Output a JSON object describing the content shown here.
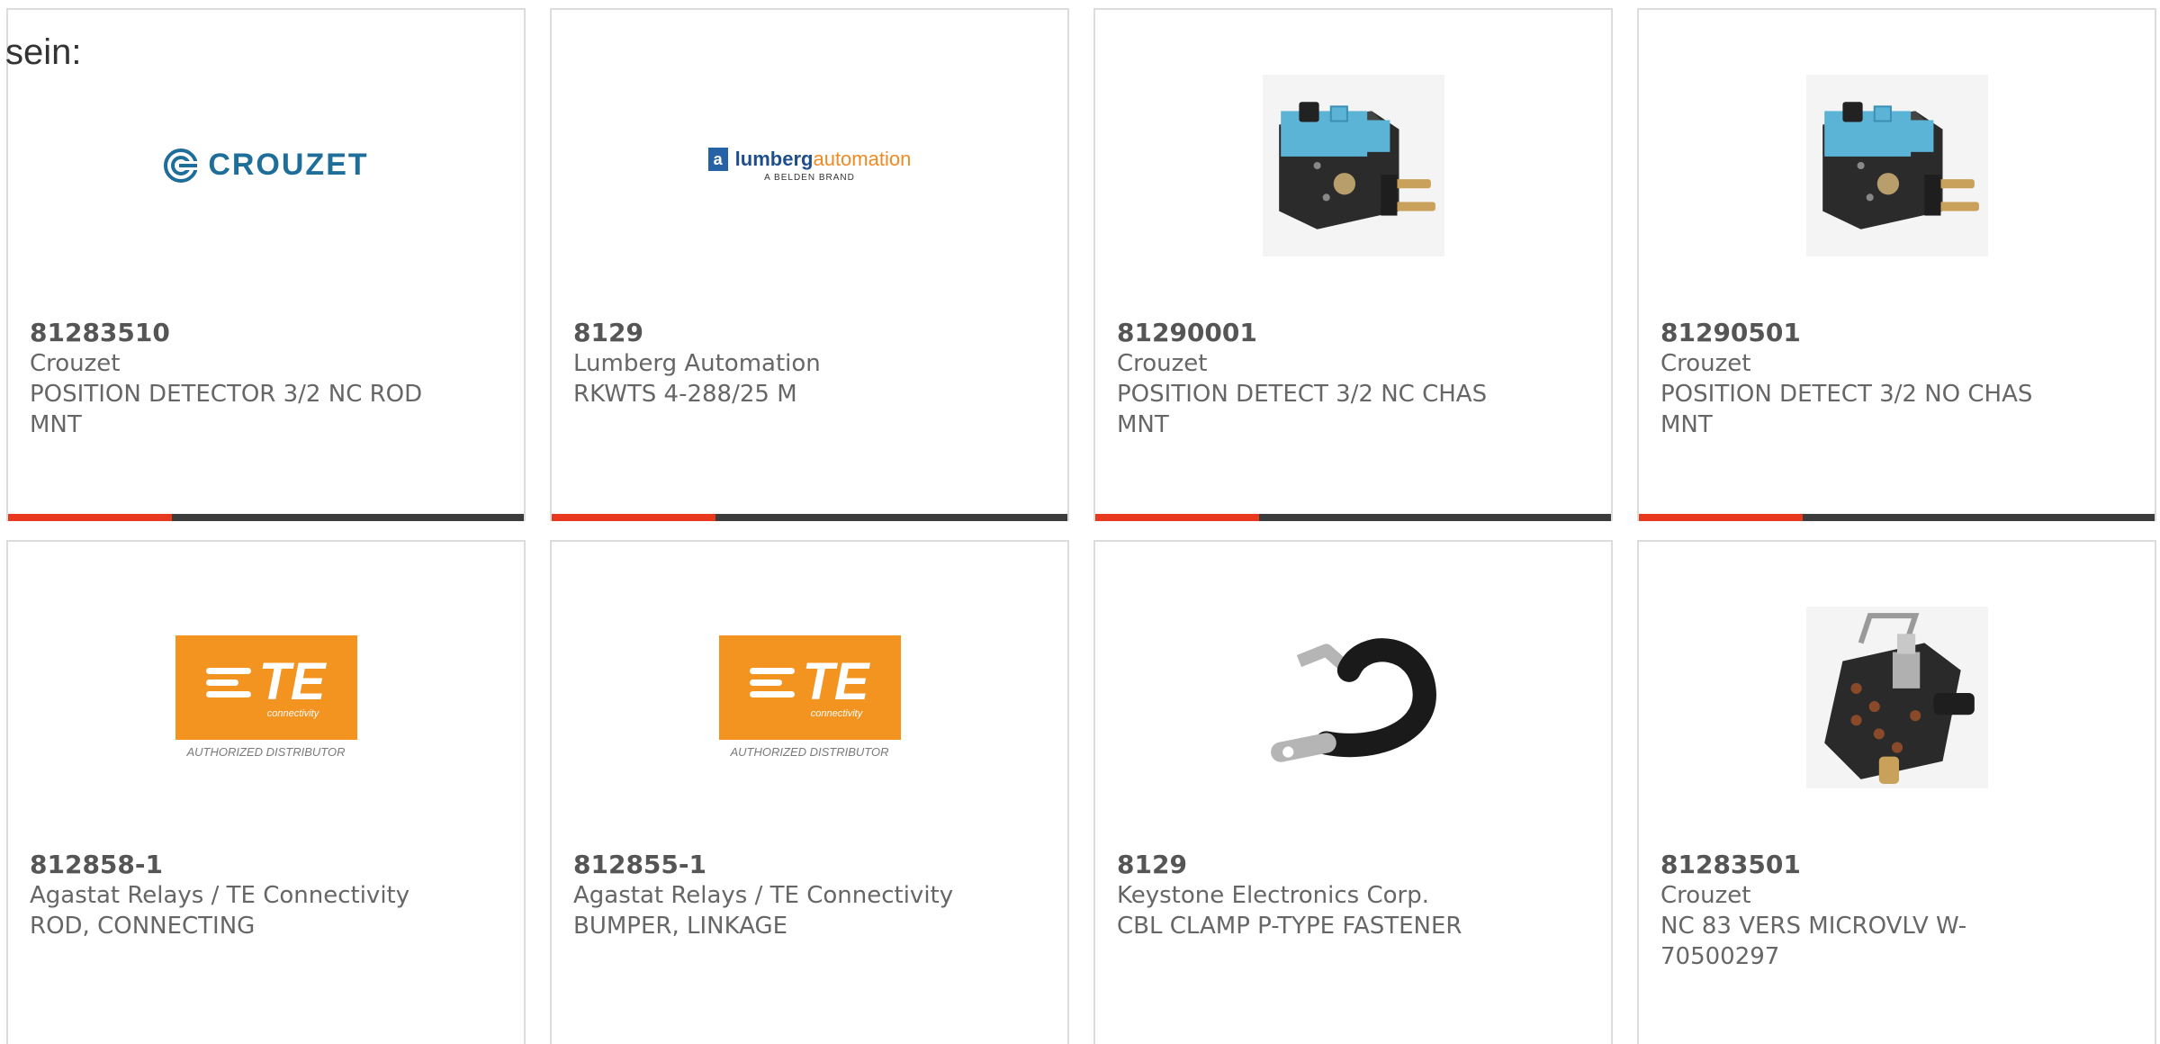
{
  "intro_text": "sein:",
  "products": [
    {
      "part_number": "81283510",
      "manufacturer": "Crouzet",
      "description": "POSITION DETECTOR 3/2 NC ROD MNT",
      "image": "crouzet-logo",
      "logo_text": "CROUZET"
    },
    {
      "part_number": "8129",
      "manufacturer": "Lumberg Automation",
      "description": "RKWTS 4-288/25 M",
      "image": "lumberg-automation-logo",
      "logo_box_letter": "a",
      "logo_name_main": "lumberg",
      "logo_name_accent": "automation",
      "logo_sub": "A BELDEN BRAND"
    },
    {
      "part_number": "81290001",
      "manufacturer": "Crouzet",
      "description": "POSITION DETECT 3/2 NC CHAS MNT",
      "image": "position-detector-photo"
    },
    {
      "part_number": "81290501",
      "manufacturer": "Crouzet",
      "description": "POSITION DETECT 3/2 NO CHAS MNT",
      "image": "position-detector-photo"
    },
    {
      "part_number": "812858-1",
      "manufacturer": "Agastat Relays / TE Connectivity",
      "description": "ROD, CONNECTING",
      "image": "te-connectivity-logo",
      "logo_letters": "TE",
      "logo_sub": "connectivity",
      "logo_caption": "AUTHORIZED DISTRIBUTOR"
    },
    {
      "part_number": "812855-1",
      "manufacturer": "Agastat Relays / TE Connectivity",
      "description": "BUMPER, LINKAGE",
      "image": "te-connectivity-logo",
      "logo_letters": "TE",
      "logo_sub": "connectivity",
      "logo_caption": "AUTHORIZED DISTRIBUTOR"
    },
    {
      "part_number": "8129",
      "manufacturer": "Keystone Electronics Corp.",
      "description": "CBL CLAMP P-TYPE FASTENER",
      "image": "cable-clamp-photo"
    },
    {
      "part_number": "81283501",
      "manufacturer": "Crouzet",
      "description": "NC 83 VERS MICROVLV W-70500297",
      "image": "microvalve-photo"
    }
  ],
  "colors": {
    "accent": "#e8391e",
    "bar_dark": "#3c3c3c",
    "te_orange": "#f39320",
    "crouzet_blue": "#1f6e9a",
    "detector_blue": "#5bb3d6"
  }
}
